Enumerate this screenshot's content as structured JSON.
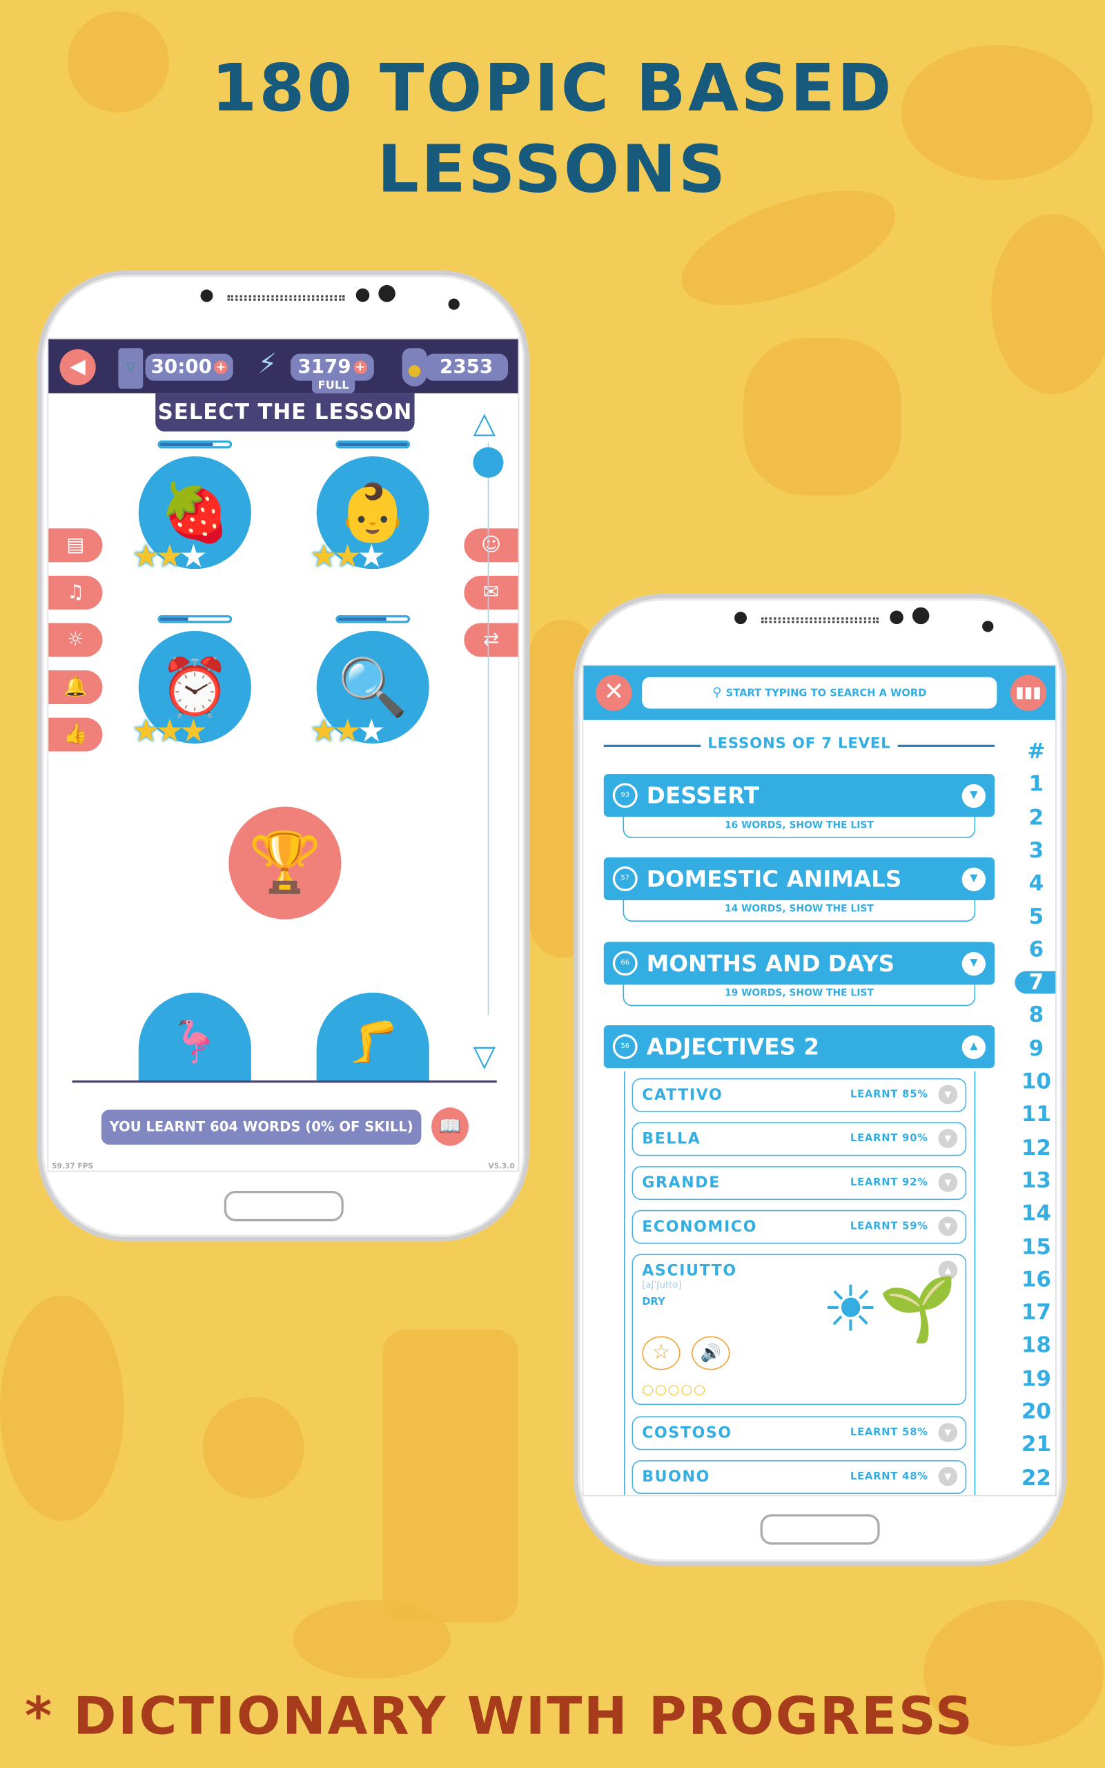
{
  "headline": {
    "line1": "180 TOPIC BASED",
    "line2": "LESSONS"
  },
  "footer": {
    "text": "* DICTIONARY WITH PROGRESS"
  },
  "colors": {
    "background": "#f4cd58",
    "headline": "#175a7c",
    "footer": "#a63c1c",
    "navy": "#35305e",
    "blue": "#33ade2",
    "salmon": "#f0807a"
  },
  "left_screen": {
    "stats": {
      "time": "30:00",
      "energy": "3179",
      "energy_status": "FULL",
      "coins": "2353"
    },
    "title": "SELECT THE LESSON",
    "lessons": [
      {
        "icon": "strawberry-icon",
        "glyph": "🍓",
        "progress": 0.75,
        "stars": 2
      },
      {
        "icon": "baby-icon",
        "glyph": "👶",
        "progress": 1.0,
        "stars": 2
      },
      {
        "icon": "alarm-clock-icon",
        "glyph": "⏰",
        "progress": 0.4,
        "stars": 3
      },
      {
        "icon": "magnifier-paw-icon",
        "glyph": "🔍",
        "progress": 0.7,
        "stars": 2
      }
    ],
    "left_buttons": [
      {
        "icon": "book-icon",
        "glyph": "▤"
      },
      {
        "icon": "music-off-icon",
        "glyph": "♫"
      },
      {
        "icon": "brightness-icon",
        "glyph": "☼"
      },
      {
        "icon": "bell-icon",
        "glyph": "🔔"
      },
      {
        "icon": "thumbs-up-icon",
        "glyph": "👍"
      }
    ],
    "right_buttons": [
      {
        "icon": "face-icon",
        "glyph": "☺"
      },
      {
        "icon": "mail-icon",
        "glyph": "✉"
      },
      {
        "icon": "users-swap-icon",
        "glyph": "⇄"
      }
    ],
    "learnt_text": "YOU LEARNT 604 WORDS (0% OF SKILL)",
    "fps": "59.37 FPS",
    "version": "V5.3.0"
  },
  "right_screen": {
    "search_placeholder": "START TYPING TO SEARCH A WORD",
    "level_title": "LESSONS OF 7 LEVEL",
    "index": [
      "#",
      "1",
      "2",
      "3",
      "4",
      "5",
      "6",
      "7",
      "8",
      "9",
      "10",
      "11",
      "12",
      "13",
      "14",
      "15",
      "16",
      "17",
      "18",
      "19",
      "20",
      "21",
      "22"
    ],
    "active_index": "7",
    "lessons": [
      {
        "name": "DESSERT",
        "badge": "93",
        "sub": "16 WORDS, SHOW THE LIST"
      },
      {
        "name": "DOMESTIC ANIMALS",
        "badge": "57",
        "sub": "14 WORDS, SHOW THE LIST"
      },
      {
        "name": "MONTHS AND DAYS",
        "badge": "66",
        "sub": "19 WORDS, SHOW THE LIST"
      },
      {
        "name": "ADJECTIVES 2",
        "badge": "56"
      }
    ],
    "words": [
      {
        "word": "CATTIVO",
        "learnt": "LEARNT 85%"
      },
      {
        "word": "BELLA",
        "learnt": "LEARNT 90%"
      },
      {
        "word": "GRANDE",
        "learnt": "LEARNT 92%"
      },
      {
        "word": "ECONOMICO",
        "learnt": "LEARNT 59%"
      }
    ],
    "expanded": {
      "word": "ASCIUTTO",
      "phonetic": "[aʃˈʃutto]",
      "translation": "DRY",
      "progress_dots": 5,
      "progress_filled": 0
    },
    "words_after": [
      {
        "word": "COSTOSO",
        "learnt": "LEARNT 58%"
      },
      {
        "word": "BUONO",
        "learnt": "LEARNT 48%"
      }
    ]
  }
}
